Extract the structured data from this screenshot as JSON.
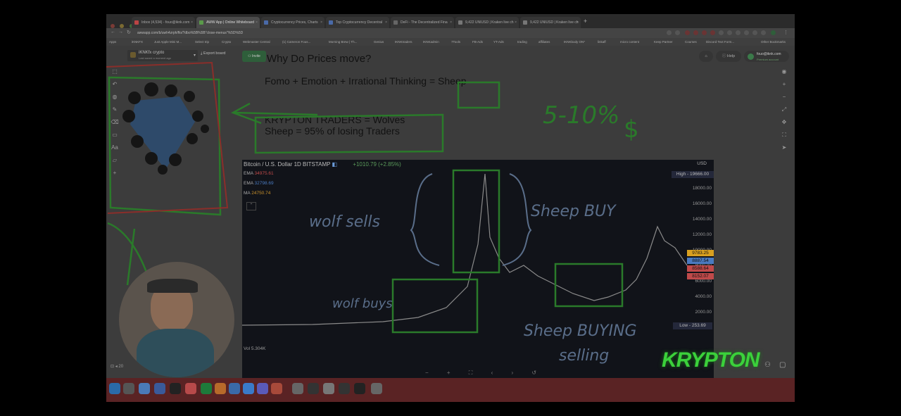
{
  "browser": {
    "tabs": [
      {
        "label": "Inbox (4,534) - fouo@iknk.com",
        "active": false
      },
      {
        "label": "AWW App | Online Whiteboard",
        "active": true
      },
      {
        "label": "Cryptocurrency Prices, Charts",
        "active": false
      },
      {
        "label": "Top Cryptocurrency Decentral",
        "active": false
      },
      {
        "label": "DeFi - The Decentralized Fina",
        "active": false
      },
      {
        "label": "9,422 UNIUSD | Kraken live ch",
        "active": false
      },
      {
        "label": "9,422 UNIUSD | Kraken live ch",
        "active": false
      }
    ],
    "url": "awwapp.com/b/uwh4zrph/flo/?dbo%5B%5B\"close-menus\"%5D%5D",
    "bookmarks": [
      "Apps",
      "iKNKFX",
      "Just Apple Mini M...",
      "Select trip",
      "Crypto",
      "Webmaster Central",
      "(1) Cameron Fous...",
      "Morning Brew | Th...",
      "Genius",
      "IKNKtraders",
      "IKNKadmin",
      "7Tools",
      "FB-Ads",
      "YT-Ads",
      "trading",
      "affiliates",
      "IKNKbody ON*",
      "linkaff",
      "micro content",
      "Keep Partner",
      "Courses",
      "Discord Text Form...",
      "Other Bookmarks"
    ]
  },
  "whiteboard": {
    "board_name": "iKNKfx crypto",
    "board_sub": "Last saved a moment ago",
    "export_label": "Export board",
    "invite_label": "Invite",
    "help_label": "Help",
    "user_email": "fouo@iknk.com",
    "user_plan": "Premium account",
    "zoom": "20",
    "logo_text": "KRYPTON"
  },
  "notes": {
    "title": "Why Do Prices move?",
    "equation": "Fomo + Emotion + Irrational Thinking = Sheep",
    "line1": "KRYPTON TRADERS = Wolves",
    "line2": "Sheep = 95% of losing Traders"
  },
  "handwriting": {
    "range": "5-10%",
    "dollar": "$",
    "wolf_sells": "wolf sells",
    "sheep_buy": "Sheep BUY",
    "wolf_buys": "wolf buys",
    "sheep_buying": "Sheep BUYING",
    "selling": "selling"
  },
  "chart": {
    "symbol": "Bitcoin / U.S. Dollar  1D  BITSTAMP",
    "change": "+1010.79 (+2.85%)",
    "currency": "USD",
    "indicators": [
      {
        "name": "EMA",
        "value": "34975.61",
        "color": "#c04a4a"
      },
      {
        "name": "EMA",
        "value": "32798.69",
        "color": "#4a7ac0"
      },
      {
        "name": "MA",
        "value": "24750.74",
        "color": "#c8902a"
      }
    ],
    "high": "High - 19666.00",
    "low": "Low - 253.69",
    "volume": "Vol  5.304K",
    "price_labels": [
      {
        "text": "9783.25",
        "color": "#d8a020"
      },
      {
        "text": "8887.54",
        "color": "#4a7ac0"
      },
      {
        "text": "8588.64",
        "color": "#c04a4a"
      },
      {
        "text": "8152.07",
        "color": "#c04a4a"
      }
    ],
    "ticks": [
      "18000.00",
      "16000.00",
      "14000.00",
      "12000.00",
      "10000.00",
      "8000.00",
      "6000.00",
      "4000.00",
      "2000.00"
    ]
  }
}
